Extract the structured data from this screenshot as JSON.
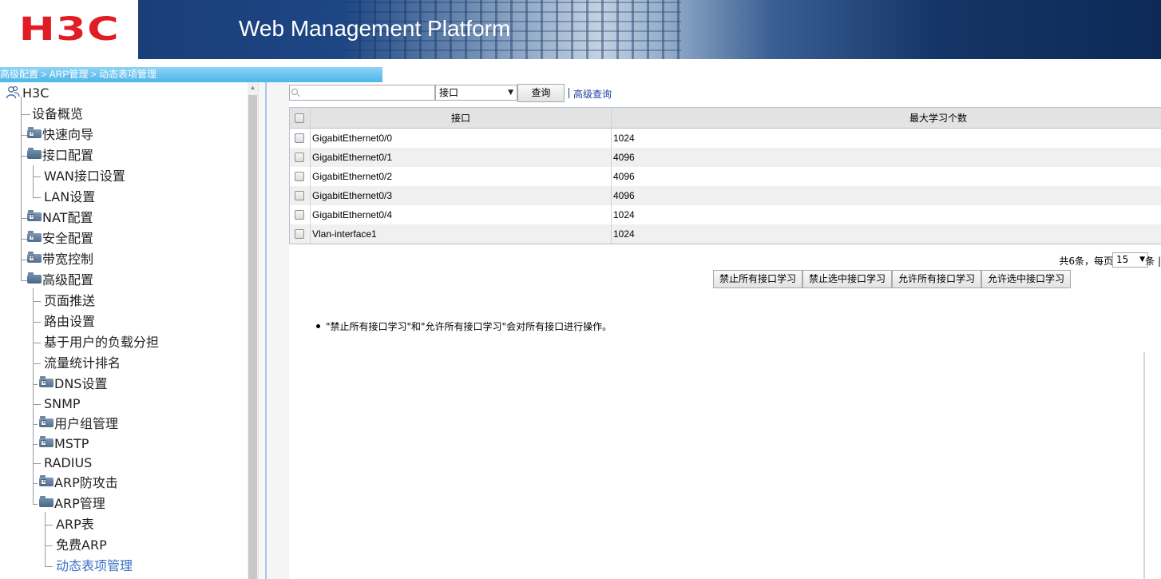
{
  "header": {
    "logo": "H3C",
    "title": "Web Management Platform"
  },
  "breadcrumb": "高级配置 > ARP管理 > 动态表项管理",
  "sidebar": {
    "root": "H3C",
    "items": [
      {
        "label": "设备概览"
      },
      {
        "label": "快速向导"
      },
      {
        "label": "接口配置"
      },
      {
        "label": "WAN接口设置"
      },
      {
        "label": "LAN设置"
      },
      {
        "label": "NAT配置"
      },
      {
        "label": "安全配置"
      },
      {
        "label": "带宽控制"
      },
      {
        "label": "高级配置"
      },
      {
        "label": "页面推送"
      },
      {
        "label": "路由设置"
      },
      {
        "label": "基于用户的负载分担"
      },
      {
        "label": "流量统计排名"
      },
      {
        "label": "DNS设置"
      },
      {
        "label": "SNMP"
      },
      {
        "label": "用户组管理"
      },
      {
        "label": "MSTP"
      },
      {
        "label": "RADIUS"
      },
      {
        "label": "ARP防攻击"
      },
      {
        "label": "ARP管理"
      },
      {
        "label": "ARP表"
      },
      {
        "label": "免费ARP"
      },
      {
        "label": "动态表项管理"
      }
    ]
  },
  "search": {
    "value": "",
    "field_selected": "接口",
    "query_label": "查询",
    "advanced_label": "高级查询"
  },
  "table": {
    "headers": [
      "接口",
      "最大学习个数"
    ],
    "rows": [
      {
        "interface": "GigabitEthernet0/0",
        "max": "1024"
      },
      {
        "interface": "GigabitEthernet0/1",
        "max": "4096"
      },
      {
        "interface": "GigabitEthernet0/2",
        "max": "4096"
      },
      {
        "interface": "GigabitEthernet0/3",
        "max": "4096"
      },
      {
        "interface": "GigabitEthernet0/4",
        "max": "1024"
      },
      {
        "interface": "Vlan-interface1",
        "max": "1024"
      }
    ]
  },
  "pager": {
    "total_prefix": "共6条，每页",
    "page_size": "15",
    "unit": "条 |"
  },
  "actions": {
    "disable_all": "禁止所有接口学习",
    "disable_selected": "禁止选中接口学习",
    "enable_all": "允许所有接口学习",
    "enable_selected": "允许选中接口学习"
  },
  "notes": [
    "\"禁止所有接口学习\"和\"允许所有接口学习\"会对所有接口进行操作。"
  ],
  "colors": {
    "logo_red": "#e21c23",
    "breadcrumb_blue": "#4cb6ea",
    "banner_dark": "#1a3e78",
    "link_blue": "#1c3fa5",
    "active_tree": "#3a6fc4"
  }
}
